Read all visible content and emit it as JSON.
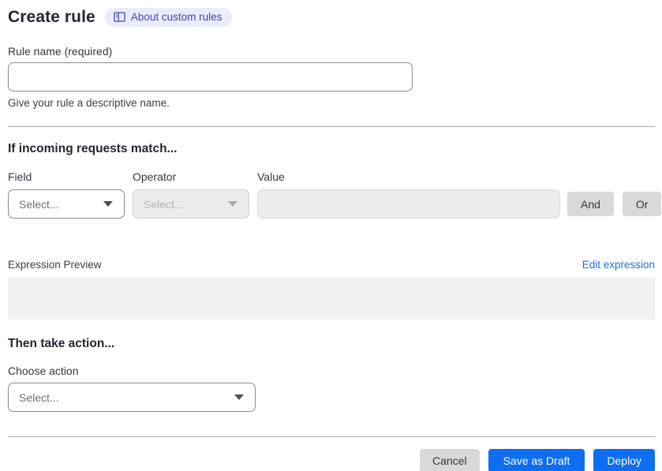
{
  "header": {
    "title": "Create rule",
    "about_badge": {
      "label": "About custom rules",
      "icon": "book-icon"
    }
  },
  "rule_name": {
    "label": "Rule name (required)",
    "value": "",
    "help": "Give your rule a descriptive name."
  },
  "match_section": {
    "heading": "If incoming requests match...",
    "field": {
      "label": "Field",
      "selected": "Select..."
    },
    "operator": {
      "label": "Operator",
      "selected": "Select...",
      "disabled": true
    },
    "value": {
      "label": "Value",
      "value": "",
      "disabled": true
    },
    "and_button": "And",
    "or_button": "Or",
    "expression_preview_label": "Expression Preview",
    "edit_expression_link": "Edit expression",
    "expression_value": ""
  },
  "action_section": {
    "heading": "Then take action...",
    "choose_action_label": "Choose action",
    "action_select": {
      "selected": "Select..."
    }
  },
  "footer": {
    "cancel_label": "Cancel",
    "save_draft_label": "Save as Draft",
    "deploy_label": "Deploy"
  },
  "colors": {
    "primary_blue": "#0d6ef2",
    "link_blue": "#1d6fdc",
    "badge_bg": "#ebecfa",
    "badge_text": "#3f45c4",
    "neutral_button": "#d9d9d9"
  }
}
